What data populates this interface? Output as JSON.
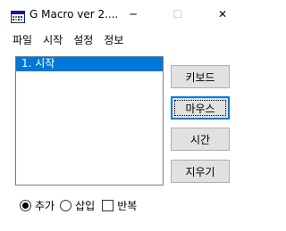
{
  "window": {
    "title": "G Macro   ver 2....",
    "minimize_glyph": "─",
    "maximize_glyph": "☐",
    "close_glyph": "✕",
    "icon": "app-icon"
  },
  "menu": [
    {
      "label": "파일"
    },
    {
      "label": "시작"
    },
    {
      "label": "설정"
    },
    {
      "label": "정보"
    }
  ],
  "list": {
    "items": [
      {
        "label": "1. 시작",
        "selected": true
      }
    ]
  },
  "buttons": {
    "keyboard": "키보드",
    "mouse": "마우스",
    "time": "시간",
    "erase": "지우기"
  },
  "options": {
    "add": {
      "label": "추가",
      "checked": true
    },
    "insert": {
      "label": "삽입",
      "checked": false
    },
    "repeat": {
      "label": "반복",
      "checked": false
    }
  },
  "colors": {
    "selection": "#0078d7",
    "button_face": "#e1e1e1"
  }
}
